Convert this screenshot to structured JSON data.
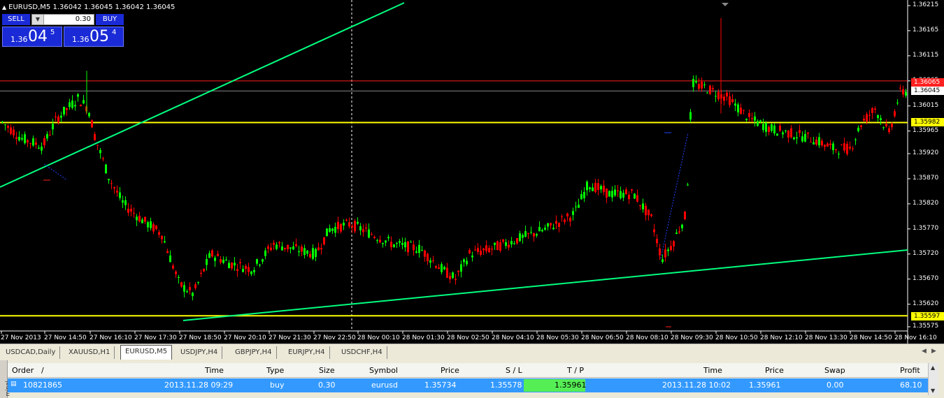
{
  "chart": {
    "title": "EURUSD,M5  1.36042 1.36045 1.36042 1.36045",
    "sell_label": "SELL",
    "buy_label": "BUY",
    "lot_value": "0.30",
    "sell_prefix": "1.36",
    "sell_big": "04",
    "sell_sup": "5",
    "buy_prefix": "1.36",
    "buy_big": "05",
    "buy_sup": "4",
    "price_labels": {
      "bid": "1.36045",
      "red": "1.36065",
      "tp": "1.35982",
      "sl": "1.35597"
    },
    "y_ticks": [
      "1.36215",
      "1.36165",
      "1.36115",
      "1.36065",
      "1.36015",
      "1.35965",
      "1.35920",
      "1.35870",
      "1.35820",
      "1.35770",
      "1.35720",
      "1.35670",
      "1.35620",
      "1.35575"
    ],
    "x_ticks": [
      "27 Nov 2013",
      "27 Nov 14:50",
      "27 Nov 16:10",
      "27 Nov 17:30",
      "27 Nov 18:50",
      "27 Nov 20:10",
      "27 Nov 21:30",
      "27 Nov 22:50",
      "28 Nov 00:10",
      "28 Nov 01:30",
      "28 Nov 02:50",
      "28 Nov 04:10",
      "28 Nov 05:30",
      "28 Nov 06:50",
      "28 Nov 08:10",
      "28 Nov 09:30",
      "28 Nov 10:50",
      "28 Nov 12:10",
      "28 Nov 13:30",
      "28 Nov 14:50",
      "28 Nov 16:10"
    ],
    "colors": {
      "bull": "#00ff00",
      "bear": "#ff0000",
      "bid_line": "#ff2020",
      "level_line": "#ffff00",
      "trend_line": "#00ff7f",
      "background": "#000000"
    }
  },
  "tabs": [
    "USDCAD,Daily",
    "XAUUSD,H1",
    "EURUSD,M5",
    "USDJPY,H4",
    "GBPJPY,H4",
    "EURJPY,H4",
    "USDCHF,H4"
  ],
  "active_tab": "EURUSD,M5",
  "terminal": {
    "side_label": "minal",
    "columns": [
      "Order",
      "/",
      "Time",
      "Type",
      "Size",
      "Symbol",
      "Price",
      "S / L",
      "T / P",
      "Time",
      "Price",
      "Swap",
      "Profit"
    ],
    "row": {
      "order": "10821865",
      "open_time": "2013.11.28 09:29",
      "type": "buy",
      "size": "0.30",
      "symbol": "eurusd",
      "price": "1.35734",
      "sl": "1.35578",
      "tp": "1.35961",
      "close_time": "2013.11.28 10:02",
      "close_price": "1.35961",
      "swap": "0.00",
      "profit": "68.10"
    }
  }
}
